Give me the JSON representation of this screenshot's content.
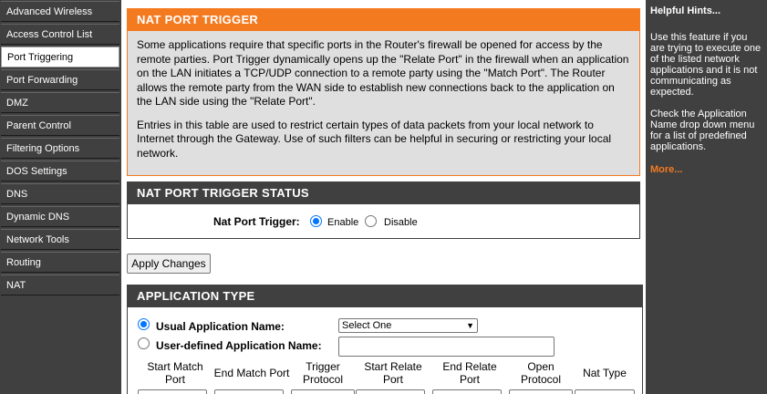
{
  "sidebar": {
    "items": [
      {
        "label": "Advanced Wireless"
      },
      {
        "label": "Access Control List"
      },
      {
        "label": "Port Triggering"
      },
      {
        "label": "Port Forwarding"
      },
      {
        "label": "DMZ"
      },
      {
        "label": "Parent Control"
      },
      {
        "label": "Filtering Options"
      },
      {
        "label": "DOS Settings"
      },
      {
        "label": "DNS"
      },
      {
        "label": "Dynamic DNS"
      },
      {
        "label": "Network Tools"
      },
      {
        "label": "Routing"
      },
      {
        "label": "NAT"
      }
    ],
    "active": "Port Triggering"
  },
  "intro": {
    "title": "NAT PORT TRIGGER",
    "para1": "Some applications require that specific ports in the Router's firewall be opened for access by the remote parties. Port Trigger dynamically opens up the \"Relate Port\" in the firewall when an application on the LAN initiates a TCP/UDP connection to a remote party using the \"Match Port\". The Router allows the remote party from the WAN side to establish new connections back to the application on the LAN side using the \"Relate Port\".",
    "para2": "Entries in this table are used to restrict certain types of data packets from your local network to Internet through the Gateway. Use of such filters can be helpful in securing or restricting your local network."
  },
  "status": {
    "title": "NAT PORT TRIGGER STATUS",
    "label": "Nat Port Trigger:",
    "enable_label": "Enable",
    "disable_label": "Disable",
    "value": "Enable"
  },
  "apply_label": "Apply Changes",
  "app_type": {
    "title": "APPLICATION TYPE",
    "usual_label": "Usual Application Name:",
    "user_label": "User-defined Application Name:",
    "selected": "usual",
    "select_value": "Select One",
    "user_value": "",
    "columns": [
      {
        "line1": "Start Match",
        "line2": "Port"
      },
      {
        "line1": "End Match Port",
        "line2": ""
      },
      {
        "line1": "Trigger",
        "line2": "Protocol"
      },
      {
        "line1": "Start Relate",
        "line2": "Port"
      },
      {
        "line1": "End Relate",
        "line2": "Port"
      },
      {
        "line1": "Open",
        "line2": "Protocol"
      },
      {
        "line1": "Nat Type",
        "line2": ""
      }
    ]
  },
  "hints": {
    "title": "Helpful Hints...",
    "text1": "Use this feature if you are trying to execute one of the listed network applications and it is not communicating as expected.",
    "text2": "Check the Application Name drop down menu for a list of predefined applications.",
    "more": "More..."
  }
}
